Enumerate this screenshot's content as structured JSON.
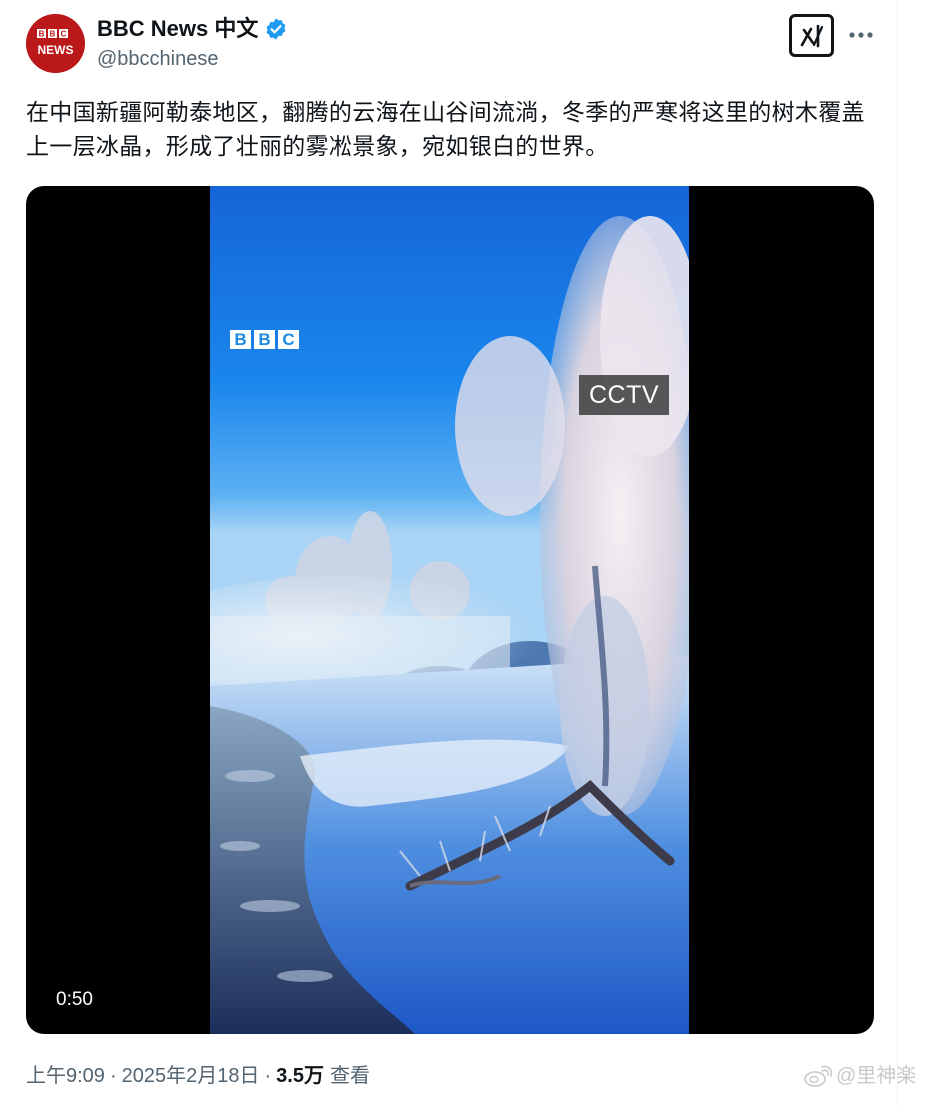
{
  "account": {
    "display_name": "BBC News 中文",
    "handle": "@bbcchinese",
    "avatar_line1": "BBC",
    "avatar_line2": "NEWS",
    "verified_color": "#1d9bf0"
  },
  "tweet": {
    "text": "在中国新疆阿勒泰地区，翻腾的云海在山谷间流淌，冬季的严寒将这里的树木覆盖上一层冰晶，形成了壮丽的雾凇景象，宛如银白的世界。"
  },
  "video": {
    "duration": "0:50",
    "watermark_bbc": [
      "B",
      "B",
      "C"
    ],
    "watermark_cctv": "CCTV"
  },
  "meta": {
    "time": "上午9:09",
    "date": "2025年2月18日",
    "separator": "·",
    "views_count": "3.5万",
    "views_label": "查看"
  },
  "overlay": {
    "weibo_watermark": "@里神楽"
  },
  "icons": {
    "verified": "verified-badge-icon",
    "grok": "grok-icon",
    "more": "more-horizontal-icon",
    "weibo": "weibo-icon"
  }
}
